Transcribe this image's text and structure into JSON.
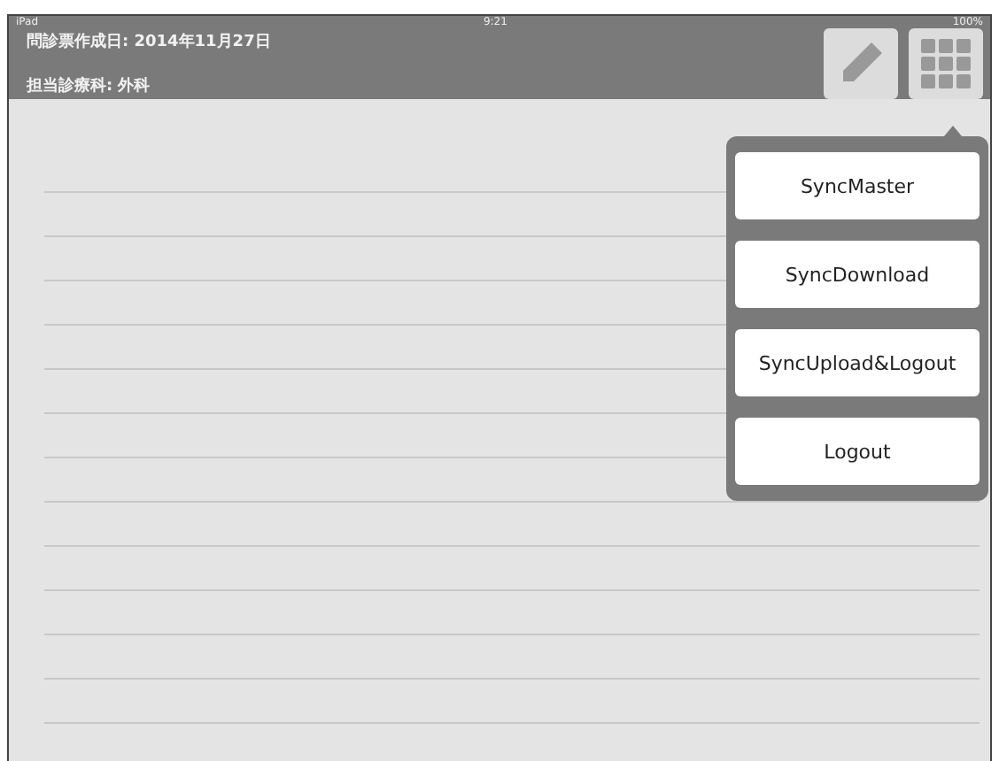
{
  "status_bar": {
    "carrier": "iPad",
    "time": "9:21",
    "battery": "100%"
  },
  "header": {
    "lines": [
      "問診票作成日: 2014年11月27日",
      "担当診療科: 外科"
    ]
  },
  "menu": {
    "items": [
      "SyncMaster",
      "SyncDownload",
      "SyncUpload&Logout",
      "Logout"
    ]
  }
}
